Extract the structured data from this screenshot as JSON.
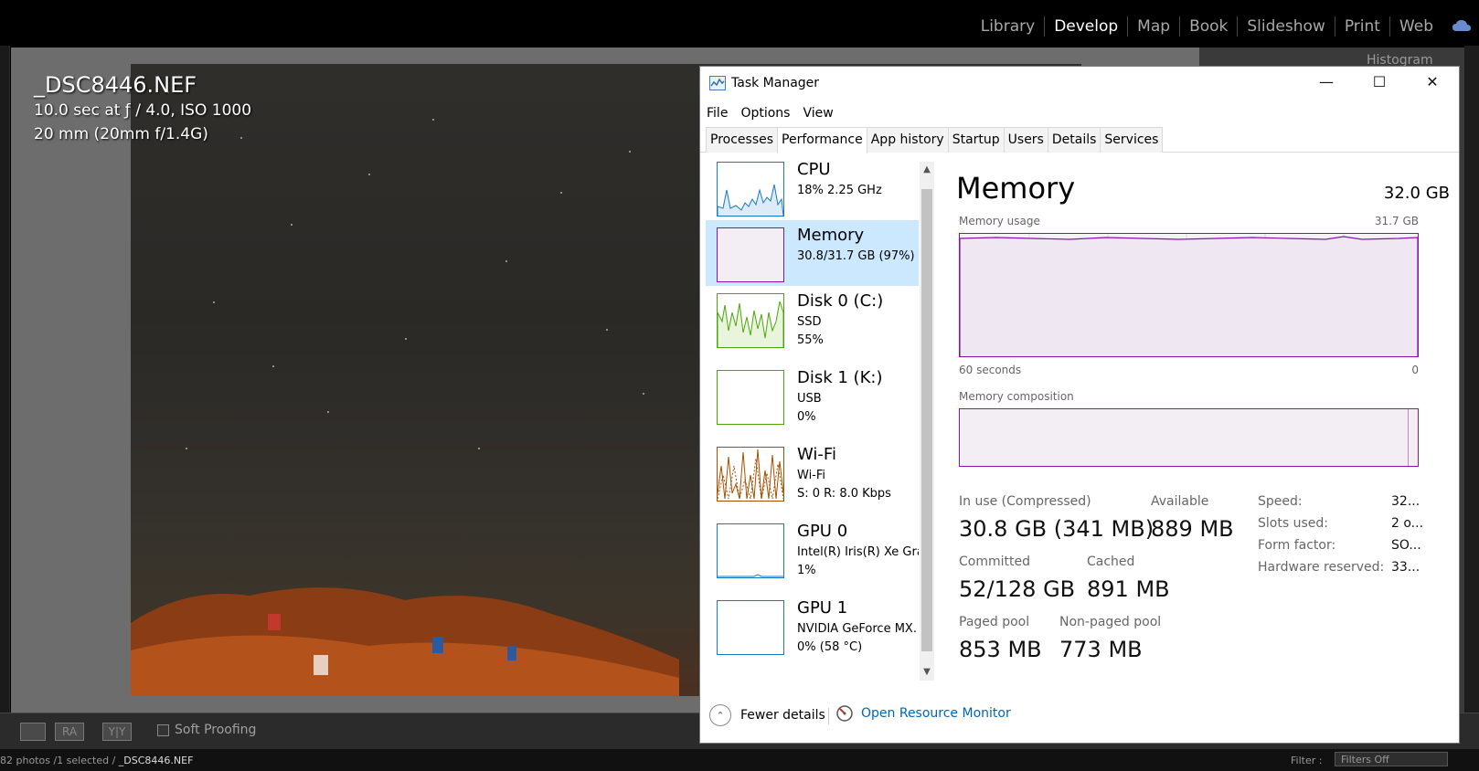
{
  "lightroom": {
    "modules": [
      "Library",
      "Develop",
      "Map",
      "Book",
      "Slideshow",
      "Print",
      "Web"
    ],
    "active_module": "Develop",
    "file_name": "_DSC8446.NEF",
    "exposure": "10.0 sec at ƒ / 4.0, ISO 1000",
    "lens": "20 mm (20mm f/1.4G)",
    "histogram_label": "Histogram",
    "toolbar": {
      "view_ra": "RA",
      "view_yy": "Y|Y",
      "soft_proofing": "Soft Proofing"
    },
    "filmstrip": {
      "status_prefix": "82 photos /1 selected /",
      "status_file": "_DSC8446.NEF",
      "filter_label": "Filter :",
      "filter_value": "Filters Off"
    }
  },
  "task_manager": {
    "title": "Task Manager",
    "menu": [
      "File",
      "Options",
      "View"
    ],
    "tabs": [
      "Processes",
      "Performance",
      "App history",
      "Startup",
      "Users",
      "Details",
      "Services"
    ],
    "active_tab": "Performance",
    "resources": [
      {
        "name": "CPU",
        "line2": "18%  2.25 GHz",
        "line3": "",
        "color": "#1b7ac4"
      },
      {
        "name": "Memory",
        "line2": "30.8/31.7 GB (97%)",
        "line3": "",
        "color": "#8b12ae"
      },
      {
        "name": "Disk 0 (C:)",
        "line2": "SSD",
        "line3": "55%",
        "color": "#4da60c"
      },
      {
        "name": "Disk 1 (K:)",
        "line2": "USB",
        "line3": "0%",
        "color": "#4da60c"
      },
      {
        "name": "Wi-Fi",
        "line2": "Wi-Fi",
        "line3": "S: 0  R: 8.0 Kbps",
        "color": "#a74f01"
      },
      {
        "name": "GPU 0",
        "line2": "Intel(R) Iris(R) Xe Gra",
        "line3": "1%",
        "color": "#1b7ac4"
      },
      {
        "name": "GPU 1",
        "line2": "NVIDIA GeForce MX.",
        "line3": "0%  (58 °C)",
        "color": "#1b7ac4"
      }
    ],
    "selected_resource": "Memory",
    "detail": {
      "title": "Memory",
      "total": "32.0 GB",
      "usage_label": "Memory usage",
      "usage_max": "31.7 GB",
      "time_left": "60 seconds",
      "time_right": "0",
      "composition_label": "Memory composition",
      "stats": {
        "in_use_label": "In use (Compressed)",
        "in_use_value": "30.8 GB (341 MB)",
        "available_label": "Available",
        "available_value": "889 MB",
        "committed_label": "Committed",
        "committed_value": "52/128 GB",
        "cached_label": "Cached",
        "cached_value": "891 MB",
        "paged_label": "Paged pool",
        "paged_value": "853 MB",
        "nonpaged_label": "Non-paged pool",
        "nonpaged_value": "773 MB"
      },
      "props": [
        {
          "label": "Speed:",
          "value": "32..."
        },
        {
          "label": "Slots used:",
          "value": "2 o..."
        },
        {
          "label": "Form factor:",
          "value": "SO..."
        },
        {
          "label": "Hardware reserved:",
          "value": "33..."
        }
      ]
    },
    "fewer_details": "Fewer details",
    "open_resource_monitor": "Open Resource Monitor"
  }
}
